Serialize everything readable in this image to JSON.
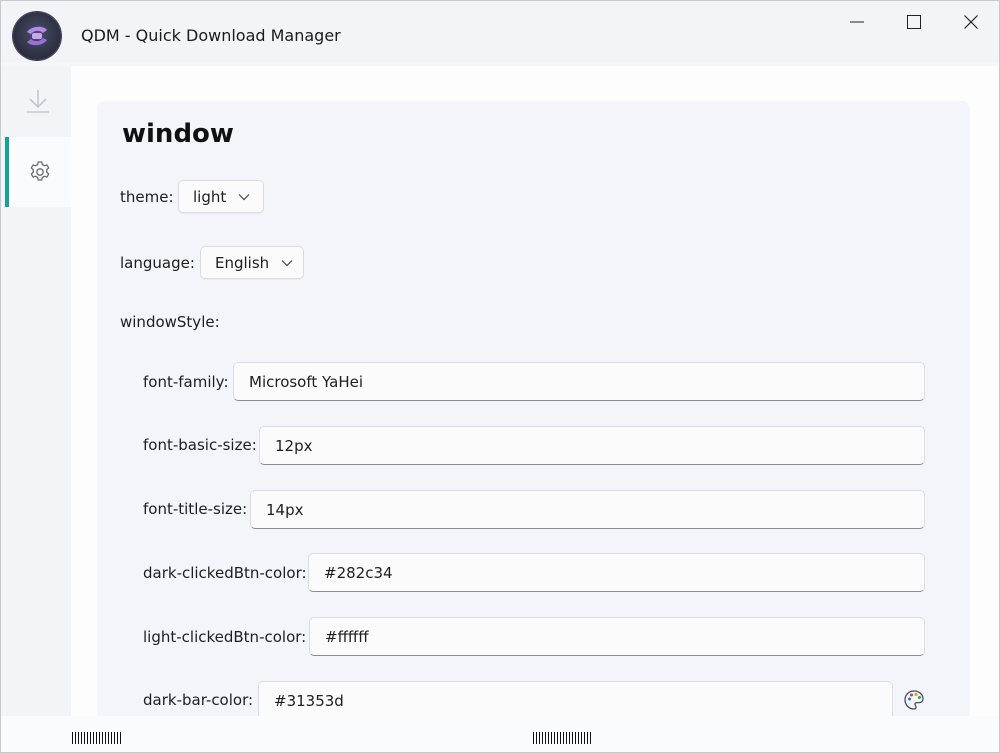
{
  "window": {
    "title": "QDM - Quick Download Manager",
    "controls": [
      "minimize",
      "maximize",
      "close"
    ]
  },
  "sidebar": {
    "items": [
      {
        "name": "downloads",
        "icon": "download-icon",
        "active": false
      },
      {
        "name": "settings",
        "icon": "gear-icon",
        "active": true
      }
    ],
    "accent": "#0fa39a"
  },
  "settings": {
    "section_title": "window",
    "theme": {
      "label": "theme:",
      "value": "light"
    },
    "language": {
      "label": "language:",
      "value": "English"
    },
    "window_style": {
      "label": "windowStyle:",
      "fields": {
        "font_family": {
          "label": "font-family:",
          "value": "Microsoft YaHei"
        },
        "font_basic_size": {
          "label": "font-basic-size:",
          "value": "12px"
        },
        "font_title_size": {
          "label": "font-title-size:",
          "value": "14px"
        },
        "dark_clicked_btn_color": {
          "label": "dark-clickedBtn-color:",
          "value": "#282c34"
        },
        "light_clicked_btn_color": {
          "label": "light-clickedBtn-color:",
          "value": "#ffffff"
        },
        "dark_bar_color": {
          "label": "dark-bar-color:",
          "value": "#31353d"
        }
      }
    }
  }
}
